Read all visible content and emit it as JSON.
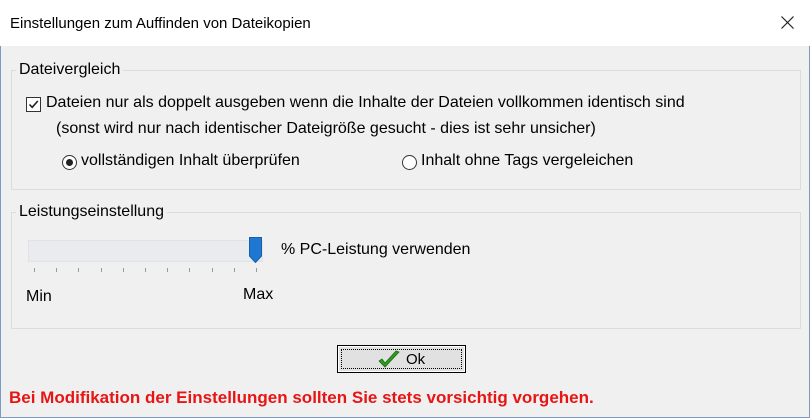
{
  "window": {
    "title": "Einstellungen zum Auffinden von Dateikopien",
    "close_icon": "close-icon"
  },
  "file_compare": {
    "group_label": "Dateivergleich",
    "identical_checkbox": {
      "checked": true,
      "label_line1": "Dateien nur als doppelt ausgeben wenn die Inhalte der Dateien vollkommen identisch sind",
      "label_line2": "(sonst wird nur nach identischer Dateigröße gesucht - dies ist sehr unsicher)"
    },
    "radio_full": {
      "label": "vollständigen Inhalt überprüfen",
      "selected": true
    },
    "radio_no_tags": {
      "label": "Inhalt ohne Tags vergeleichen",
      "selected": false
    }
  },
  "performance": {
    "group_label": "Leistungseinstellung",
    "slider_value_fraction": 1.0,
    "slider_label": "% PC-Leistung verwenden",
    "min_label": "Min",
    "max_label": "Max"
  },
  "ok_button": {
    "label": "Ok",
    "icon": "checkmark-icon"
  },
  "warning_text": "Bei Modifikation der Einstellungen sollten Sie stets vorsichtig vorgehen.",
  "colors": {
    "warning": "#e81515",
    "slider_thumb": "#1e78d2",
    "ok_check": "#2e9b20"
  }
}
